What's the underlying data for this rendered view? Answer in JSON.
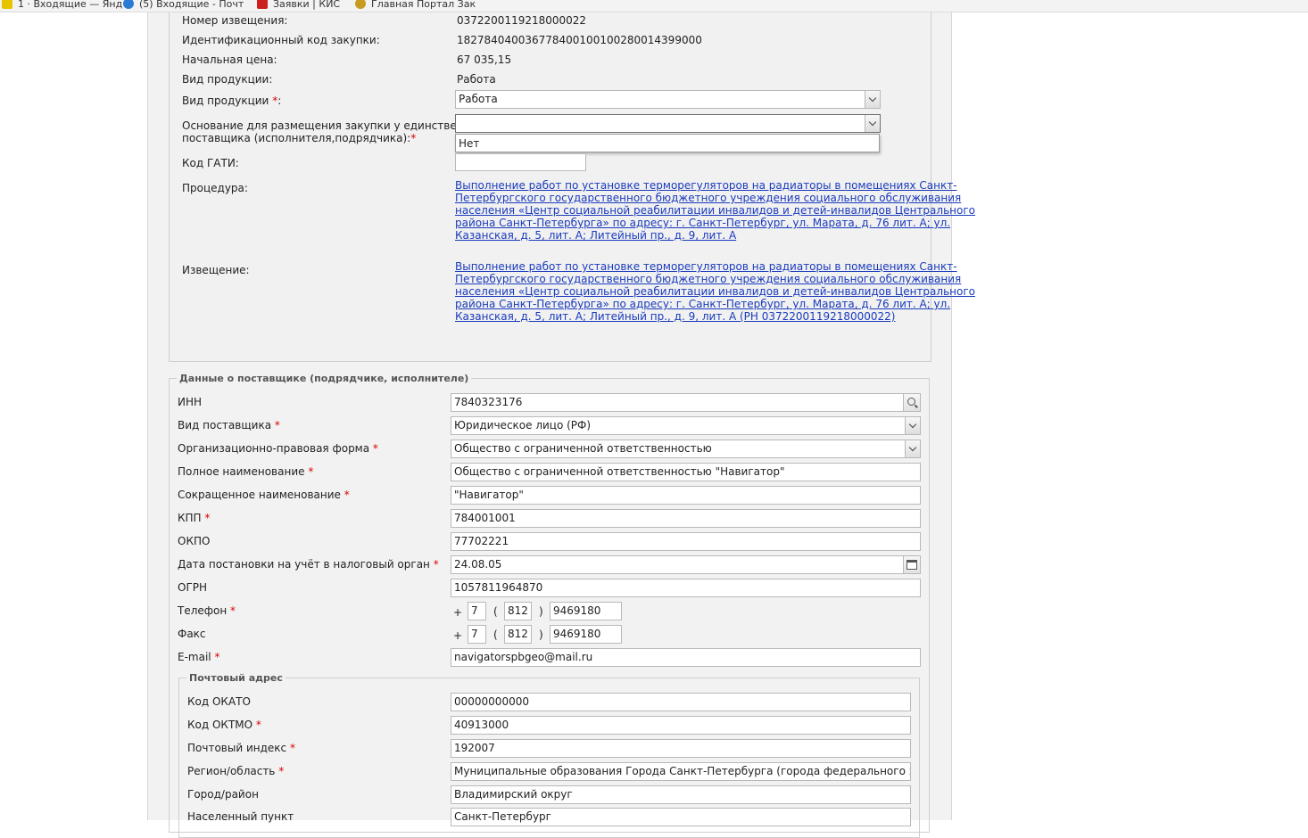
{
  "bookmarks": [
    {
      "label": "1 · Входящие — Янд",
      "color": "#e8c400"
    },
    {
      "label": "(5) Входящие - Почт",
      "color": "#2b7bd6"
    },
    {
      "label": "Заявки | КИС",
      "color": "#cc2020"
    },
    {
      "label": "Главная Портал Зак",
      "color": "#c89a20"
    }
  ],
  "procurement": {
    "notice_number_label": "Номер извещения:",
    "notice_number": "0372200119218000022",
    "id_code_label": "Идентификационный код закупки:",
    "id_code": "182784040036778400100100280014399000",
    "start_price_label": "Начальная цена:",
    "start_price": "67 035,15",
    "product_type_label": "Вид продукции:",
    "product_type": "Работа",
    "product_type_select_label": "Вид продукции ",
    "product_type_select_value": "Работа",
    "basis_label_line1": "Основание для размещения закупки у единственного",
    "basis_label_line2": "поставщика (исполнителя,подрядчика):",
    "basis_value": "",
    "basis_option": "Нет",
    "gati_label": "Код ГАТИ:",
    "gati_value": "",
    "procedure_label": "Процедура:",
    "procedure_lines": [
      "Выполнение работ по установке терморегуляторов на радиаторы в помещениях Санкт-",
      "Петербургского государственного бюджетного учреждения социального обслуживания",
      "населения «Центр социальной реабилитации инвалидов и детей-инвалидов Центрального",
      "района Санкт-Петербурга» по адресу: г. Санкт-Петербург, ул. Марата, д. 76 лит. А; ул.",
      "Казанская, д. 5, лит. А; Литейный пр., д. 9, лит. А"
    ],
    "notice_label": "Извещение:",
    "notice_lines": [
      "Выполнение работ по установке терморегуляторов на радиаторы в помещениях Санкт-",
      "Петербургского государственного бюджетного учреждения социального обслуживания",
      "населения «Центр социальной реабилитации инвалидов и детей-инвалидов Центрального",
      "района Санкт-Петербурга» по адресу: г. Санкт-Петербург, ул. Марата, д. 76 лит. А; ул.",
      "Казанская, д. 5, лит. А; Литейный пр., д. 9, лит. А (РН 0372200119218000022)"
    ]
  },
  "supplier": {
    "legend": "Данные о поставщике (подрядчике, исполнителе)",
    "inn_label": "ИНН",
    "inn": "7840323176",
    "type_label": "Вид поставщика ",
    "type": "Юридическое лицо (РФ)",
    "opf_label": "Организационно-правовая форма ",
    "opf": "Общество с ограниченной ответственностью",
    "full_name_label": "Полное наименование ",
    "full_name": "Общество с ограниченной ответственностью \"Навигатор\"",
    "short_name_label": "Сокращенное наименование ",
    "short_name": "\"Навигатор\"",
    "kpp_label": "КПП ",
    "kpp": "784001001",
    "okpo_label": "ОКПО",
    "okpo": "77702221",
    "tax_date_label": "Дата постановки на учёт в налоговый орган ",
    "tax_date": "24.08.05",
    "ogrn_label": "ОГРН",
    "ogrn": "1057811964870",
    "phone_label": "Телефон ",
    "phone": {
      "country": "7",
      "city": "812",
      "number": "9469180"
    },
    "fax_label": "Факс",
    "fax": {
      "country": "7",
      "city": "812",
      "number": "9469180"
    },
    "email_label": "E-mail ",
    "email": "navigatorspbgeo@mail.ru",
    "phone_symbols": {
      "plus": "+",
      "open": "(",
      "close": ")"
    },
    "required_mark": "*"
  },
  "postal": {
    "legend": "Почтовый адрес",
    "okato_label": "Код ОКАТО",
    "okato": "00000000000",
    "oktmo_label": "Код ОКТМО ",
    "oktmo": "40913000",
    "index_label": "Почтовый индекс ",
    "index": "192007",
    "region_label": "Регион/область ",
    "region": "Муниципальные образования Города Санкт-Петербурга (города федерального значения)",
    "city_label": "Город/район",
    "city": "Владимирский округ",
    "locality_label": "Населенный пункт",
    "locality": "Санкт-Петербург"
  }
}
